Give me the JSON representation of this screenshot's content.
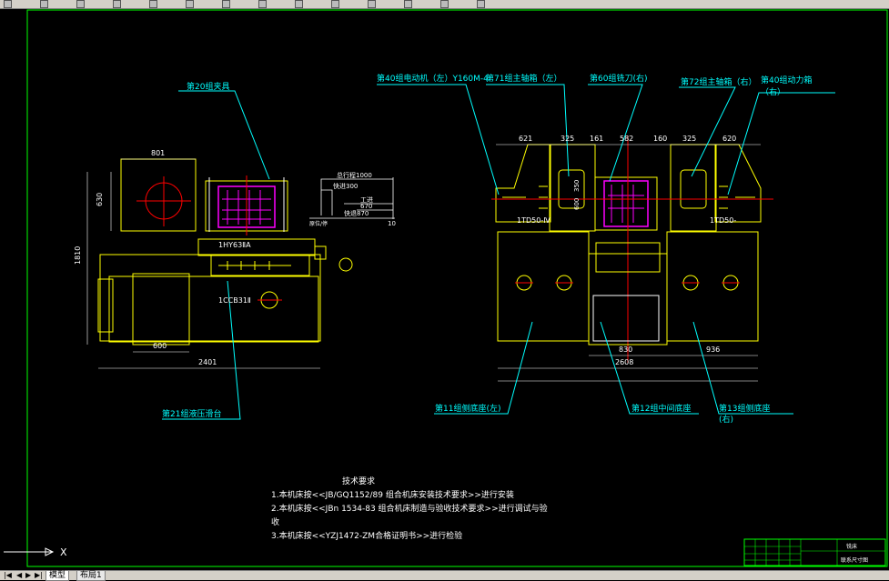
{
  "toolbar": {
    "icons": [
      "toolbar-icon-1",
      "toolbar-icon-2",
      "toolbar-icon-3",
      "toolbar-icon-4",
      "toolbar-icon-5",
      "toolbar-icon-6",
      "toolbar-icon-7",
      "toolbar-icon-8",
      "toolbar-icon-9",
      "toolbar-icon-10",
      "toolbar-icon-11",
      "toolbar-icon-12",
      "toolbar-icon-13",
      "toolbar-icon-14"
    ]
  },
  "labels": {
    "fixture": "第20组夹具",
    "hydraulic": "第21组液压滑台",
    "motor_left": "第40组电动机（左）Y160M-4",
    "spindle_left": "第71组主轴箱（左）",
    "cutter": "第60组铣刀(右)",
    "spindle_right": "第72组主轴箱（右）",
    "power_box_line1": "第40组动力箱",
    "power_box_line2": "（右）",
    "base_left": "第11组侧底座(左)",
    "base_middle": "第12组中间底座",
    "base_right_line1": "第13组侧底座",
    "base_right_line2": "(右)"
  },
  "part_labels": {
    "slide": "1HY63ⅡA",
    "pump": "1CCB31Ⅱ",
    "power_left": "1TD50-Ⅳ",
    "power_right": "1TD50-"
  },
  "stroke": {
    "total": "总行程1000",
    "fast_forward": "快进300",
    "work_feed": "工进",
    "work_value": "670",
    "fast_back": "快退870",
    "back_value": "870",
    "stop_left": "原位/停",
    "stop_right": "10"
  },
  "dimensions": {
    "d801": "801",
    "d630": "630",
    "d1810": "1810",
    "d600": "600",
    "d2401": "2401",
    "d621": "621",
    "d325a": "325",
    "d161": "161",
    "d582": "582",
    "d160": "160",
    "d325b": "325",
    "d620": "620",
    "d830": "830",
    "d936": "936",
    "d2608": "2608",
    "v600": "600",
    "v350": "350"
  },
  "notes": {
    "title": "技术要求",
    "line1": "1.本机床按<<JB/GQ1152/89 组合机床安装技术要求>>进行安装",
    "line2": "2.本机床按<<JBn 1534-83  组合机床制造与验收技术要求>>进行调试与验",
    "line2b": "收",
    "line3": "3.本机床按<<YZJ1472-ZM合格证明书>>进行检验"
  },
  "title_block": {
    "drawing_name": "联系尺寸图",
    "tag": "铣床"
  },
  "status": {
    "ucs_x": "X",
    "tabs": [
      "模型",
      "布局1"
    ]
  },
  "colors": {
    "background": "#000000",
    "frame": "#00ff00",
    "machine": "#ffff00",
    "leader": "#00ffff",
    "fixture": "#ff00ff",
    "center": "#ff0000",
    "dimension": "#ffffff"
  }
}
